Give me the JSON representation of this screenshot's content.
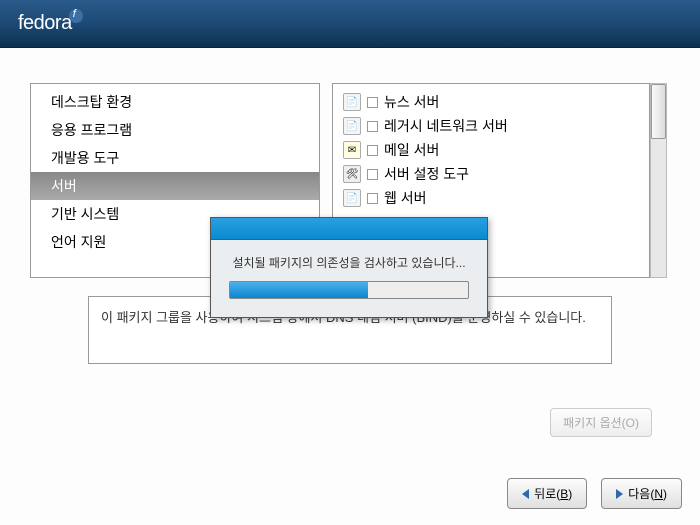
{
  "header": {
    "logo_text": "fedora"
  },
  "left_panel": {
    "categories": [
      {
        "label": "데스크탑 환경",
        "selected": false
      },
      {
        "label": "응용 프로그램",
        "selected": false
      },
      {
        "label": "개발용 도구",
        "selected": false
      },
      {
        "label": "서버",
        "selected": true
      },
      {
        "label": "기반 시스템",
        "selected": false
      },
      {
        "label": "언어 지원",
        "selected": false
      }
    ]
  },
  "right_panel": {
    "packages": [
      {
        "icon": "paper",
        "checked": false,
        "label": "뉴스 서버"
      },
      {
        "icon": "paper",
        "checked": false,
        "label": "레거시 네트워크 서버"
      },
      {
        "icon": "mail",
        "checked": false,
        "label": "메일 서버"
      },
      {
        "icon": "tools",
        "checked": false,
        "label": "서버 설정 도구"
      },
      {
        "icon": "paper",
        "checked": false,
        "label": "웹 서버"
      }
    ]
  },
  "description": {
    "text": "이 패키지 그룹을 사용하여 시스템 상에서 DNS 네임 서버 (BIND)를 운영하실 수 있습니다."
  },
  "package_options_button": "패키지 옵션(O)",
  "progress_dialog": {
    "message": "설치될 패키지의 의존성을 검사하고 있습니다...",
    "percent": 58
  },
  "footer": {
    "back": "뒤로(B)",
    "next": "다음(N)"
  }
}
